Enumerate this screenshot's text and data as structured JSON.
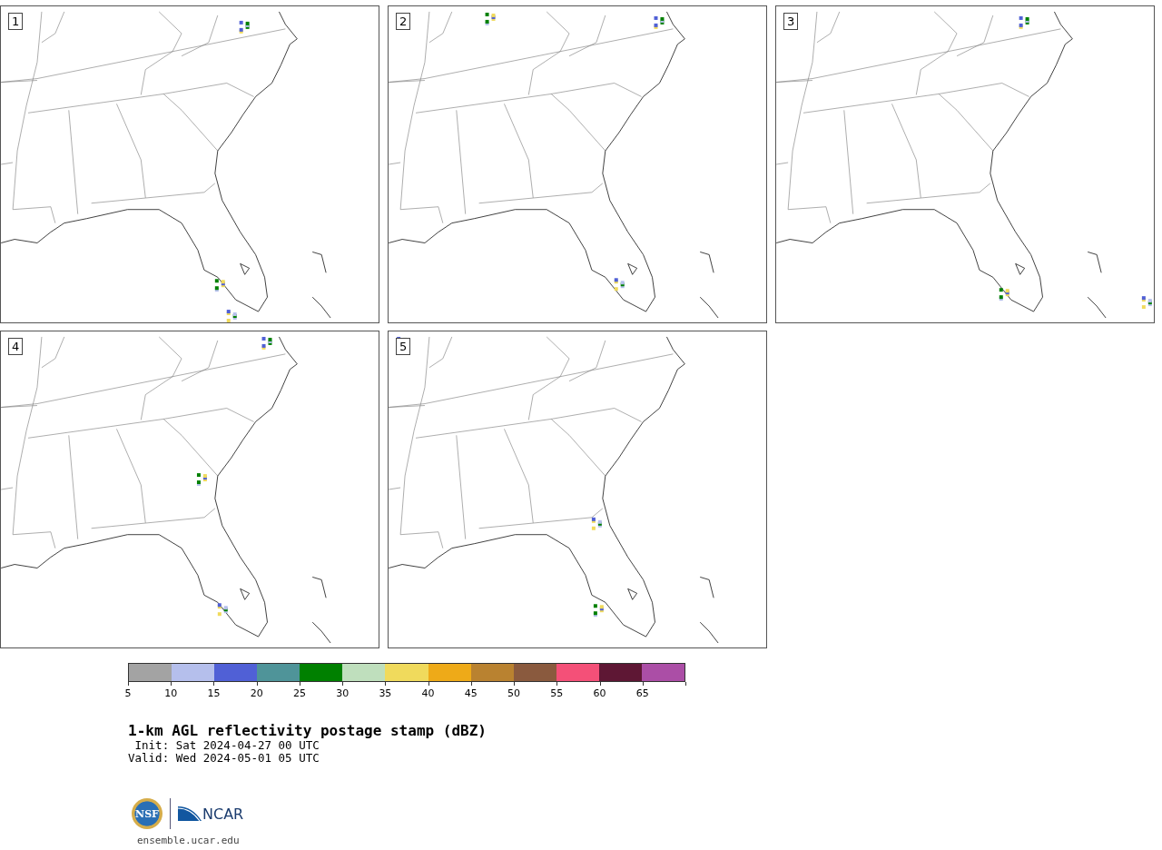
{
  "panels": [
    {
      "label": "1"
    },
    {
      "label": "2"
    },
    {
      "label": "3"
    },
    {
      "label": "4"
    },
    {
      "label": "5"
    }
  ],
  "colorbar": {
    "segments": [
      {
        "color": "#a3a3a3"
      },
      {
        "color": "#b5bfec"
      },
      {
        "color": "#5060d6"
      },
      {
        "color": "#4f9499"
      },
      {
        "color": "#008000"
      },
      {
        "color": "#bfdfbd"
      },
      {
        "color": "#f0da5c"
      },
      {
        "color": "#eeaa18"
      },
      {
        "color": "#b98230"
      },
      {
        "color": "#8a5a3e"
      },
      {
        "color": "#f45078"
      },
      {
        "color": "#5e1734"
      },
      {
        "color": "#ab4ea6"
      }
    ],
    "ticks": [
      "5",
      "10",
      "15",
      "20",
      "25",
      "30",
      "35",
      "40",
      "45",
      "50",
      "55",
      "60",
      "65"
    ]
  },
  "title": "1-km AGL reflectivity postage stamp (dBZ)",
  "init": " Init: Sat 2024-04-27 00 UTC",
  "valid": "Valid: Wed 2024-05-01 05 UTC",
  "logo": {
    "nsf_text": "NSF",
    "ncar_text": "NCAR"
  },
  "website": "ensemble.ucar.edu"
}
